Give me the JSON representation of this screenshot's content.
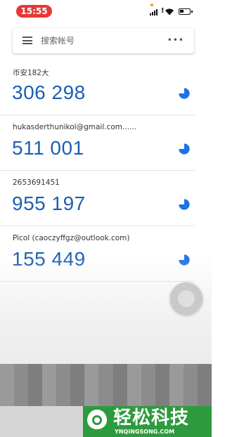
{
  "status_bar": {
    "time": "15:55",
    "time_pill_color": "#e53935",
    "signal_alert": "!",
    "battery_level": 0.45
  },
  "search": {
    "placeholder": "搜索帐号",
    "more": "•••"
  },
  "accounts": [
    {
      "name": "币安182大",
      "code": "306 298"
    },
    {
      "name": "hukasderthunikol@gmail.com......",
      "code": "511 001"
    },
    {
      "name": "2653691451",
      "code": "955 197"
    },
    {
      "name": "Picol (caoczyffgz@outlook.com)",
      "code": "155 449"
    }
  ],
  "colors": {
    "code_blue": "#1a5fb4",
    "accent_blue": "#1a73e8",
    "watermark_green": "#2e9a3e"
  },
  "watermark": {
    "title": "轻松科技",
    "url": "YNQINGSONG.COM"
  }
}
